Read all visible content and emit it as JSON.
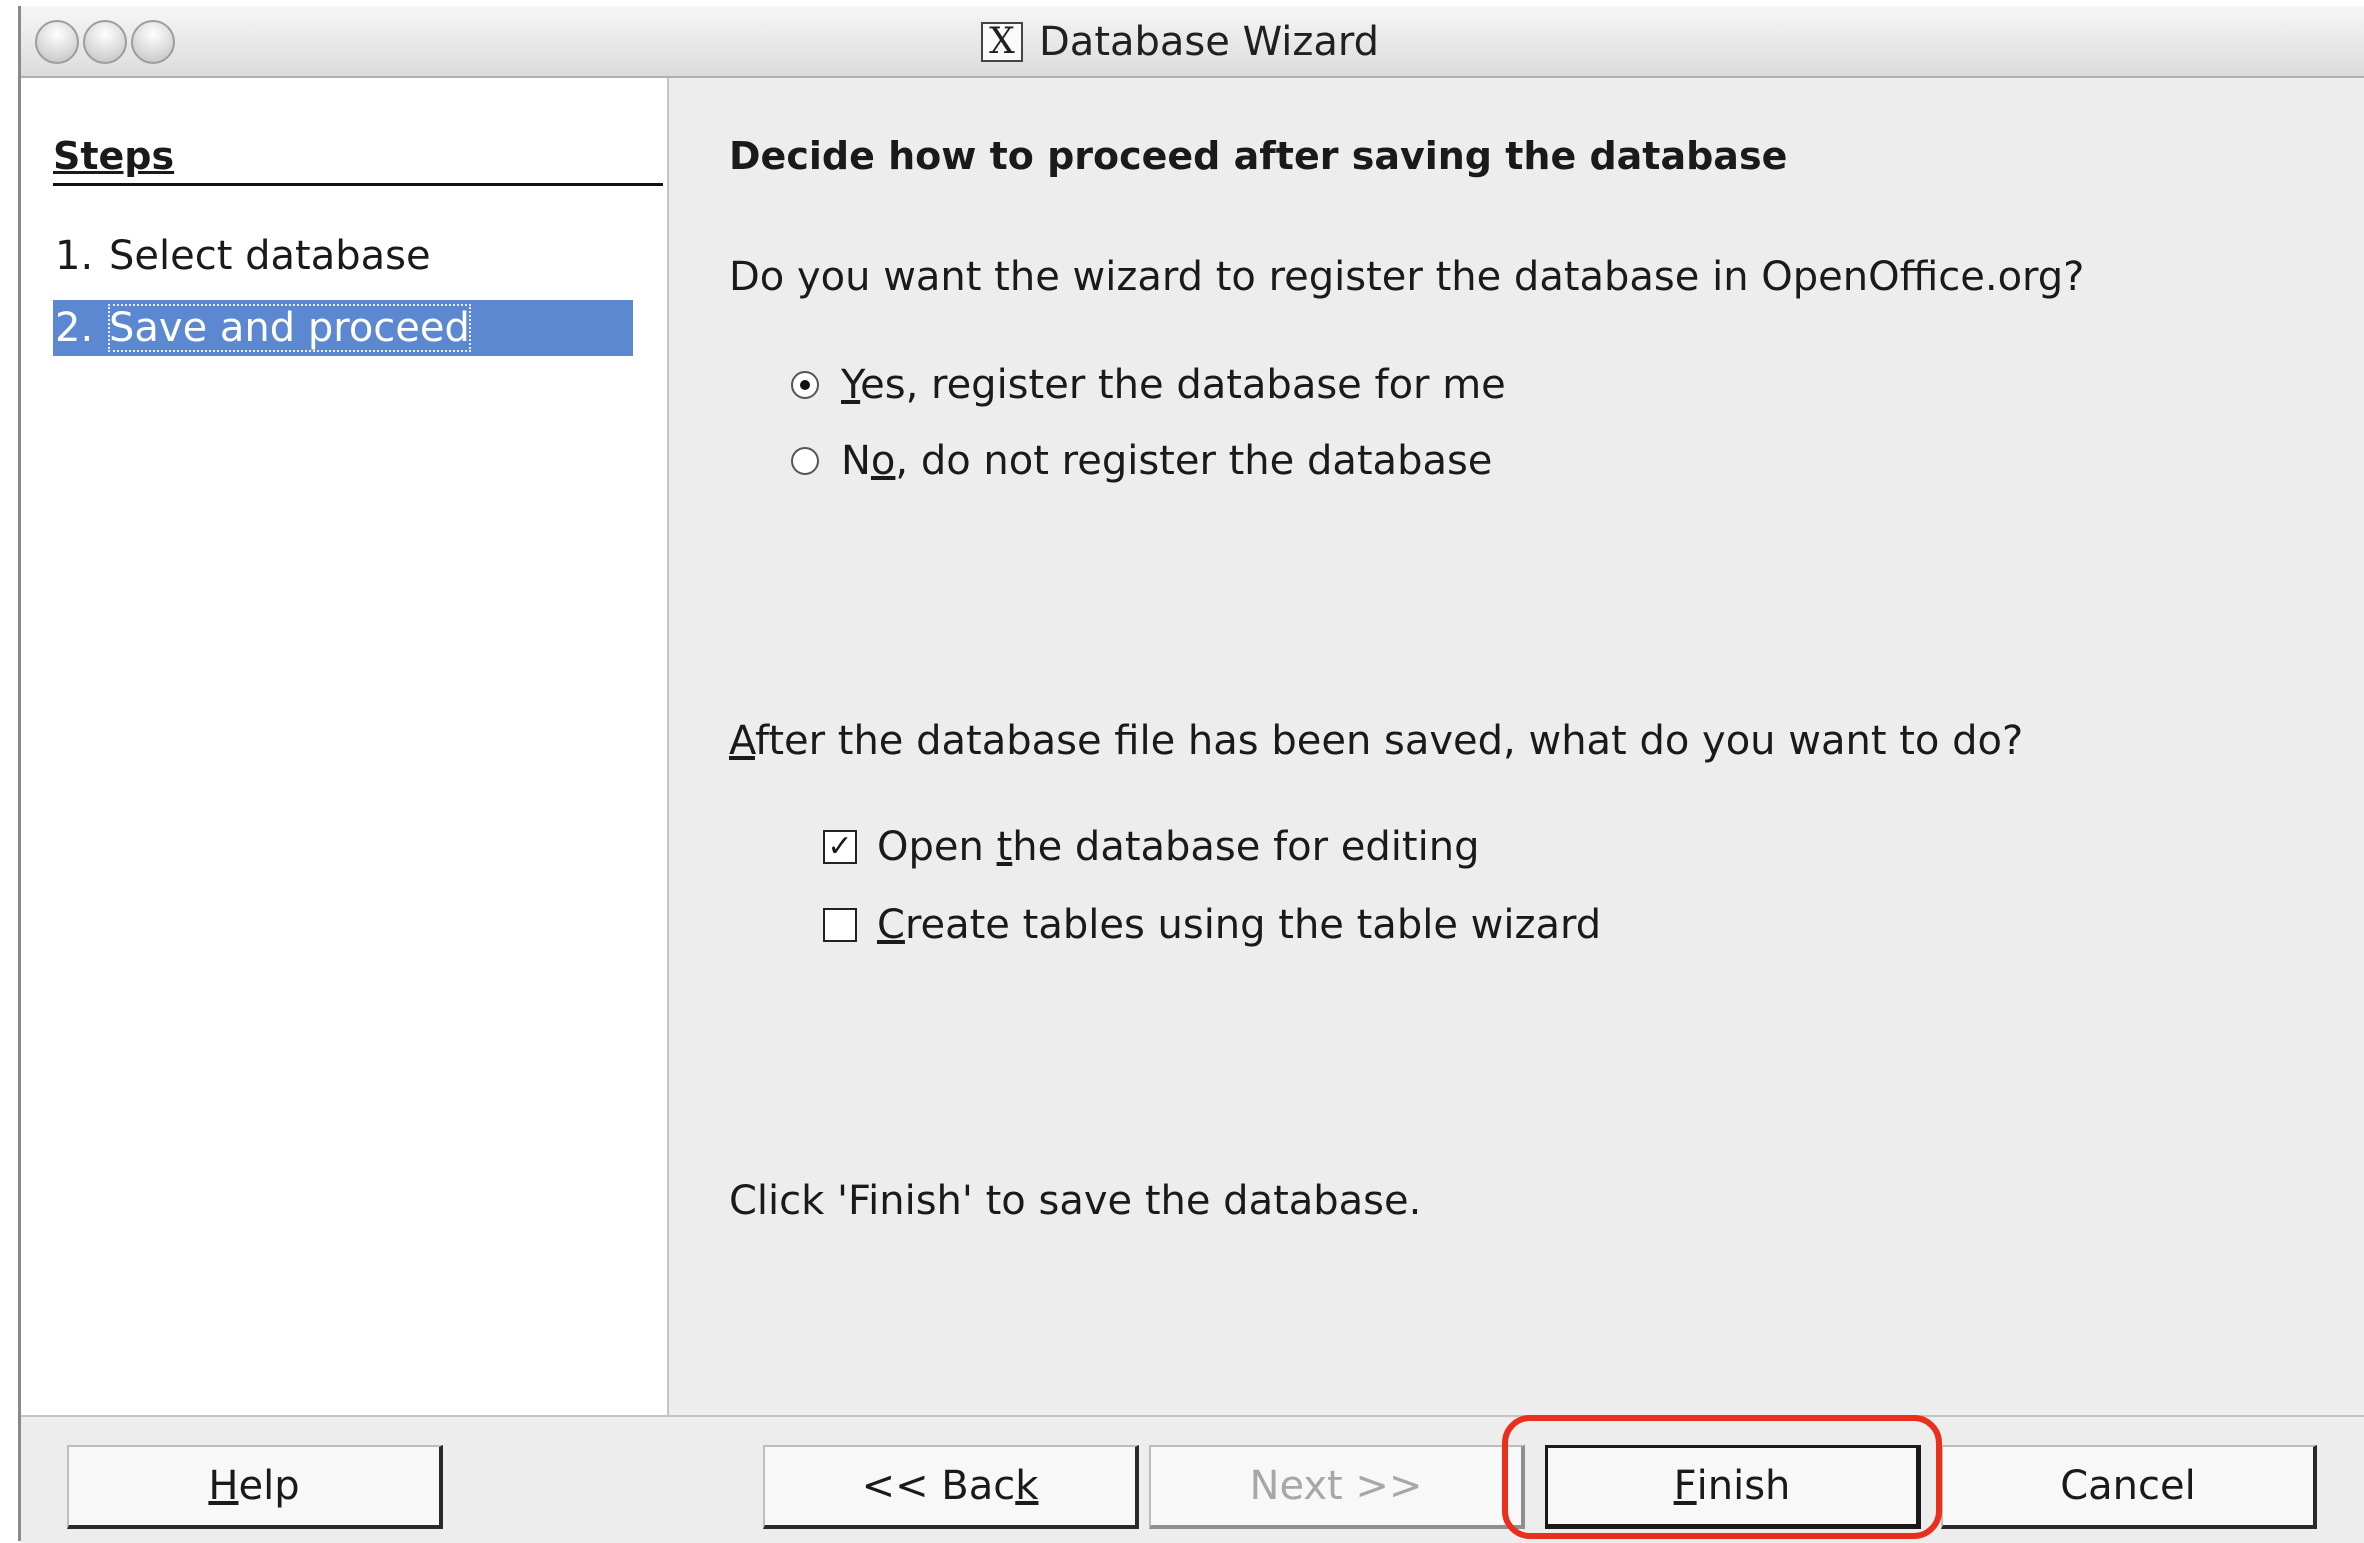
{
  "window": {
    "title": "Database Wizard",
    "title_icon": "X"
  },
  "sidebar": {
    "heading": "Steps",
    "steps": [
      {
        "number": "1.",
        "label": "Select database",
        "active": false
      },
      {
        "number": "2.",
        "label": "Save and proceed",
        "active": true
      }
    ]
  },
  "content": {
    "heading": "Decide how to proceed after saving the database",
    "register_question": "Do you want the wizard to register the database in OpenOffice.org?",
    "register_options": [
      {
        "pre": "",
        "key": "Y",
        "post": "es, register the database for me",
        "selected": true
      },
      {
        "pre": "N",
        "key": "o",
        "post": ", do not register the database",
        "selected": false
      }
    ],
    "after_save_question_key": "A",
    "after_save_question_rest": "fter the database file has been saved, what do you want to do?",
    "after_save_options": [
      {
        "pre": "Open ",
        "key": "t",
        "post": "he database for editing",
        "checked": true
      },
      {
        "pre": "",
        "key": "C",
        "post": "reate tables using the table wizard",
        "checked": false
      }
    ],
    "finish_hint": "Click 'Finish' to save the database."
  },
  "buttons": {
    "help": {
      "pre": "",
      "key": "H",
      "post": "elp"
    },
    "back": {
      "pre": "<< Bac",
      "key": "k",
      "post": ""
    },
    "next": {
      "label": "Next >>",
      "enabled": false
    },
    "finish": {
      "pre": "",
      "key": "F",
      "post": "inish"
    },
    "cancel": {
      "label": "Cancel"
    }
  },
  "colors": {
    "selection": "#5b88d1",
    "highlight_annotation": "#e8301c"
  }
}
